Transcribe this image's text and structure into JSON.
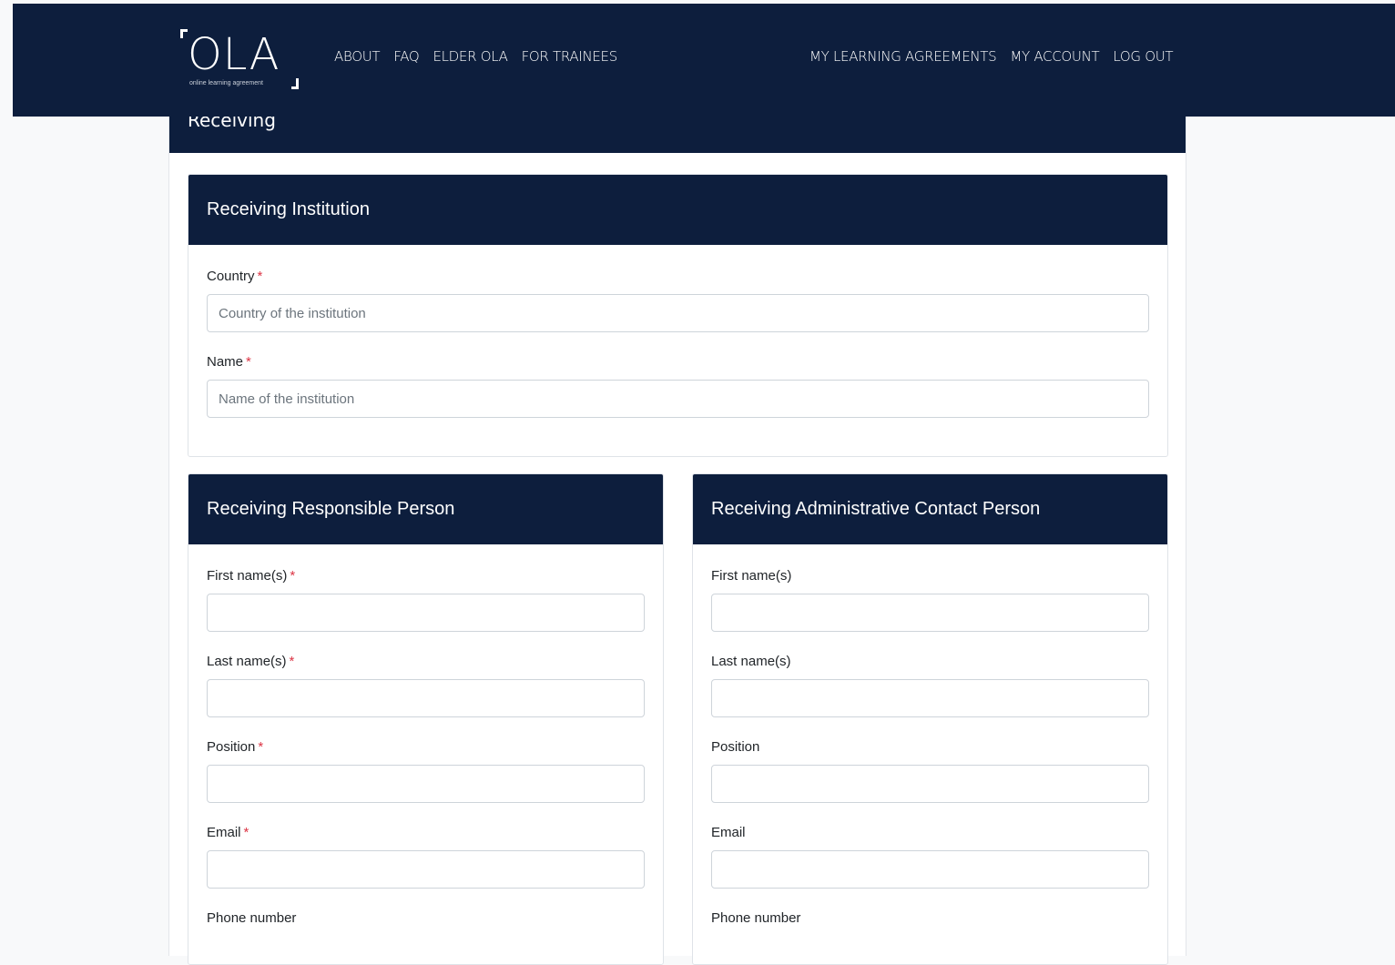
{
  "header": {
    "logo_text": "OLA",
    "logo_tagline": "online learning agreement",
    "nav_left": [
      "ABOUT",
      "FAQ",
      "ELDER OLA",
      "FOR TRAINEES"
    ],
    "nav_right": [
      "MY LEARNING AGREEMENTS",
      "MY ACCOUNT",
      "LOG OUT"
    ]
  },
  "section": {
    "title": "Receiving"
  },
  "institution": {
    "title": "Receiving Institution",
    "country_label": "Country",
    "country_placeholder": "Country of the institution",
    "name_label": "Name",
    "name_placeholder": "Name of the institution"
  },
  "responsible": {
    "title": "Receiving Responsible Person",
    "first_name_label": "First name(s)",
    "last_name_label": "Last name(s)",
    "position_label": "Position",
    "email_label": "Email",
    "phone_label": "Phone number"
  },
  "administrative": {
    "title": "Receiving Administrative Contact Person",
    "first_name_label": "First name(s)",
    "last_name_label": "Last name(s)",
    "position_label": "Position",
    "email_label": "Email",
    "phone_label": "Phone number"
  },
  "required_marker": "*",
  "colors": {
    "navy": "#0d1e3d",
    "required": "#dc3545"
  }
}
